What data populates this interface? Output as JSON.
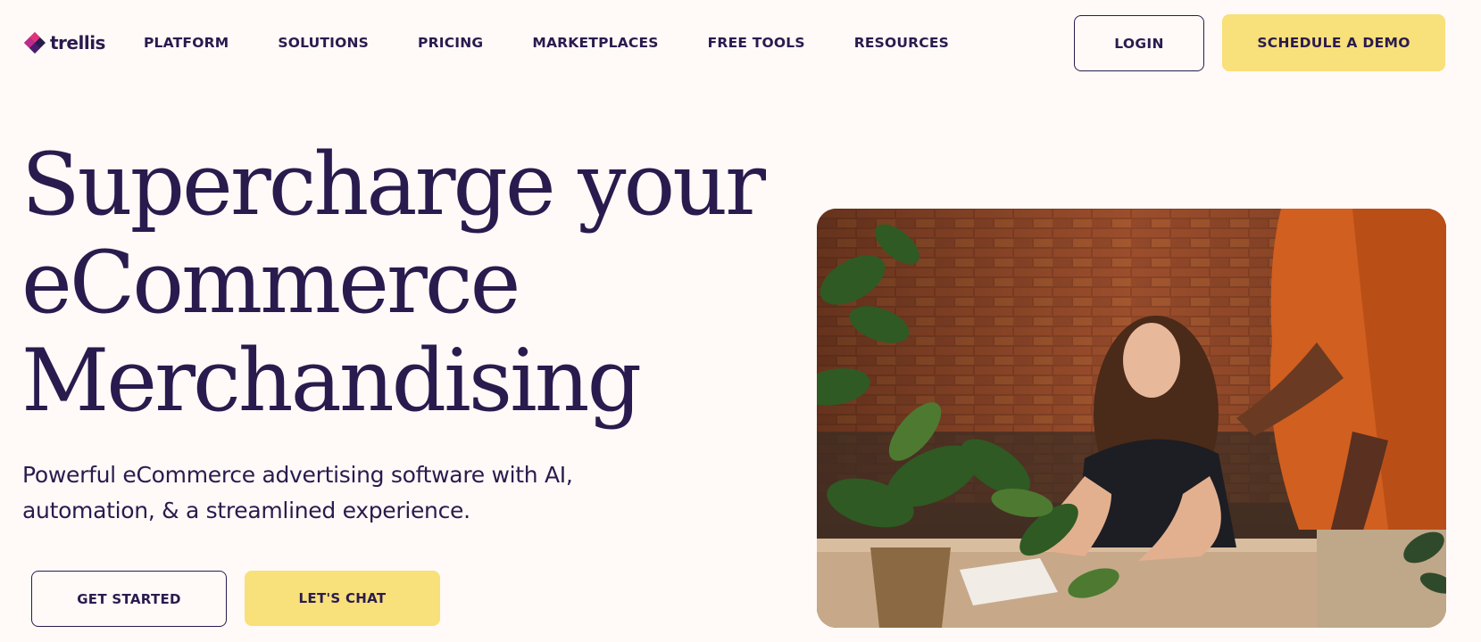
{
  "brand": {
    "name": "trellis",
    "colors": {
      "text": "#2a1b4e",
      "accent": "#f8e07a",
      "background": "#fffaf7",
      "logo_pink": "#e0337a"
    }
  },
  "nav": {
    "links": [
      "PLATFORM",
      "SOLUTIONS",
      "PRICING",
      "MARKETPLACES",
      "FREE TOOLS",
      "RESOURCES"
    ],
    "login_label": "LOGIN",
    "demo_label": "SCHEDULE A DEMO"
  },
  "hero": {
    "title_lines": [
      "Supercharge your",
      "eCommerce",
      "Merchandising"
    ],
    "subtitle_lines": [
      "Powerful eCommerce advertising software with AI,",
      "automation, & a streamlined experience."
    ],
    "get_started_label": "GET STARTED",
    "lets_chat_label": "LET'S CHAT"
  },
  "photo": {
    "subject": "woman-smiling-at-desk-with-plants-and-man-in-orange-shirt"
  }
}
